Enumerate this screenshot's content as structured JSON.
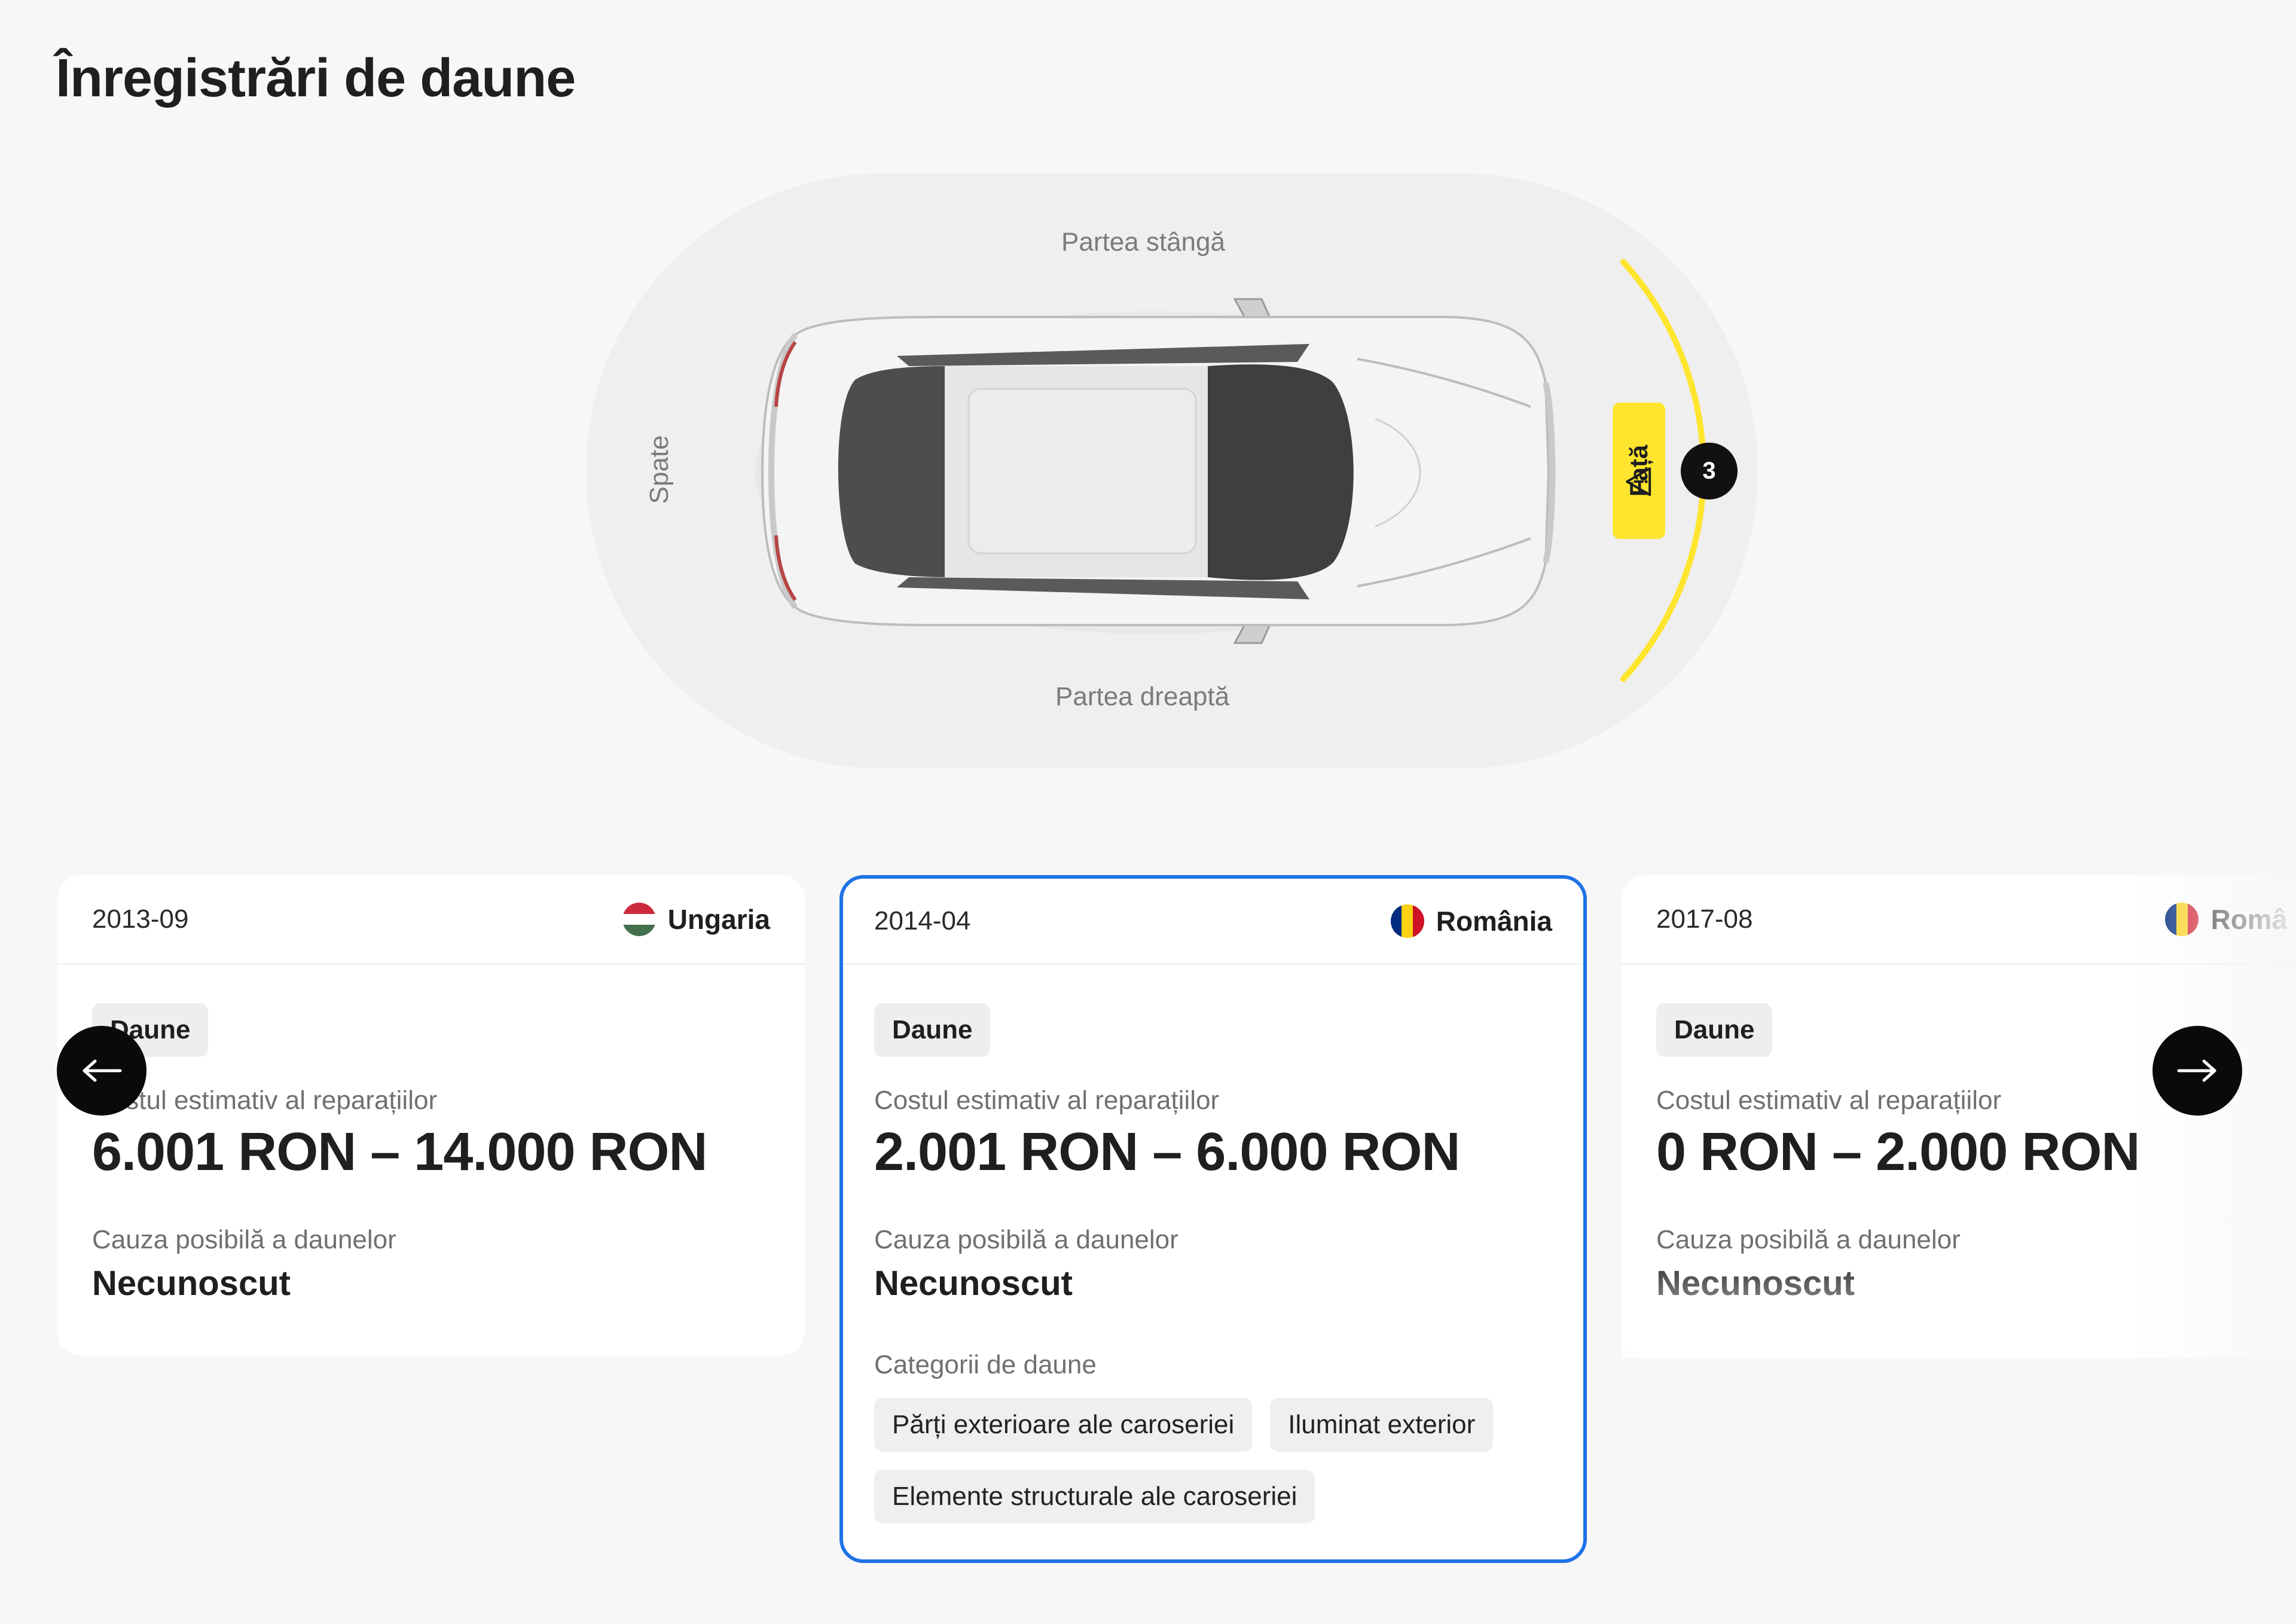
{
  "page": {
    "title": "Înregistrări de daune"
  },
  "diagram": {
    "labels": {
      "left": "Partea stângă",
      "right": "Partea dreaptă",
      "back": "Spate",
      "front": "Față"
    },
    "front_count": "3",
    "highlight_color": "#ffe52e"
  },
  "cards": [
    {
      "date": "2013-09",
      "country": "Ungaria",
      "flag": "hungary-flag",
      "chip": "Daune",
      "cost_label": "Costul estimativ al reparațiilor",
      "cost_value": "6.001 RON – 14.000 RON",
      "cause_label": "Cauza posibilă a daunelor",
      "cause_value": "Necunoscut"
    },
    {
      "date": "2014-04",
      "country": "România",
      "flag": "romania-flag",
      "chip": "Daune",
      "cost_label": "Costul estimativ al reparațiilor",
      "cost_value": "2.001 RON – 6.000 RON",
      "cause_label": "Cauza posibilă a daunelor",
      "cause_value": "Necunoscut",
      "categories_label": "Categorii de daune",
      "categories": [
        "Părți exterioare ale caroseriei",
        "Iluminat exterior",
        "Elemente structurale ale caroseriei"
      ],
      "selected": true
    },
    {
      "date": "2017-08",
      "country": "Româ",
      "flag": "romania-flag",
      "chip": "Daune",
      "cost_label": "Costul estimativ al reparațiilor",
      "cost_value": "0 RON – 2.000 RON",
      "cause_label": "Cauza posibilă a daunelor",
      "cause_value": "Necunoscut"
    }
  ],
  "navigation": {
    "prev_icon": "arrow-left-icon",
    "next_icon": "arrow-right-icon"
  },
  "colors": {
    "accent_border": "#1f72e6",
    "warning": "#ffe52e",
    "nav": "#0a0a0a"
  }
}
